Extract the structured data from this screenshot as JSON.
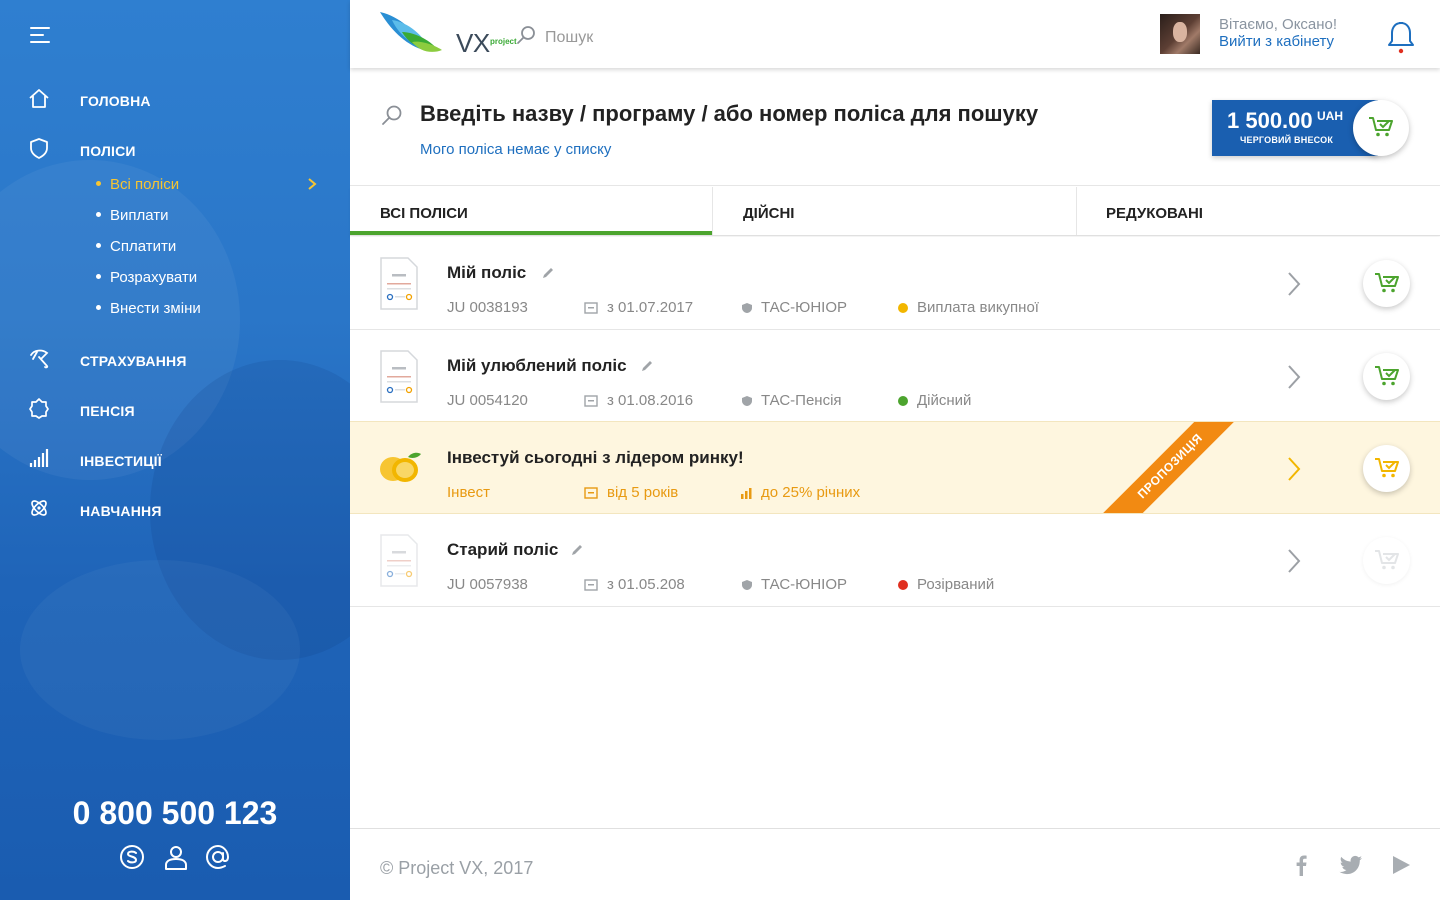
{
  "sidebar": {
    "menu_icon": "hamburger-icon",
    "items": [
      {
        "label": "ГОЛОВНА",
        "icon": "home-icon"
      },
      {
        "label": "ПОЛІСИ",
        "icon": "shield-icon"
      },
      {
        "label": "СТРАХУВАННЯ",
        "icon": "umbrella-icon"
      },
      {
        "label": "ПЕНСІЯ",
        "icon": "badge-icon"
      },
      {
        "label": "ІНВЕСТИЦІЇ",
        "icon": "bar-chart-icon"
      },
      {
        "label": "НАВЧАННЯ",
        "icon": "atom-icon"
      }
    ],
    "subitems": [
      {
        "label": "Всі поліси",
        "active": true
      },
      {
        "label": "Виплати"
      },
      {
        "label": "Сплатити"
      },
      {
        "label": "Розрахувати"
      },
      {
        "label": "Внести зміни"
      }
    ],
    "phone": "0 800 500 123",
    "contacts": [
      "skype-icon",
      "user-icon",
      "at-icon"
    ]
  },
  "header": {
    "logo_text": "VX",
    "logo_sub": "project",
    "search_placeholder": "Пошук",
    "greeting": "Вітаємо, Оксано!",
    "logout": "Вийти з кабінету"
  },
  "search_section": {
    "title": "Введіть назву / програму / або номер поліса для пошуку",
    "link": "Мого поліса немає у списку"
  },
  "payment": {
    "amount": "1 500.00",
    "currency": "UAH",
    "label": "ЧЕРГОВИЙ ВНЕСОК"
  },
  "tabs": [
    {
      "label": "ВСІ ПОЛІСИ",
      "active": true
    },
    {
      "label": "ДІЙСНІ"
    },
    {
      "label": "РЕДУКОВАНІ"
    }
  ],
  "policies": [
    {
      "title": "Мій поліс",
      "number": "JU 0038193",
      "date": "з 01.07.2017",
      "program": "ТАС-ЮНІОР",
      "status": "Виплата викупної",
      "status_color": "#f2b600"
    },
    {
      "title": "Мій улюблений поліс",
      "number": "JU 0054120",
      "date": "з 01.08.2016",
      "program": "ТАС-Пенсія",
      "status": "Дійсний",
      "status_color": "#4ca42e"
    },
    {
      "title": "Старий поліс",
      "number": "JU 0057938",
      "date": "з 01.05.208",
      "program": "ТАС-ЮНІОР",
      "status": "Розірваний",
      "status_color": "#e02f1f"
    }
  ],
  "promo": {
    "title": "Інвестуй сьогодні з лідером ринку!",
    "category": "Інвест",
    "term": "від 5 років",
    "yield": "до 25% річних",
    "ribbon": "ПРОПОЗИЦІЯ",
    "icon": "lemon-icon"
  },
  "footer": {
    "copyright": "© Project VX, 2017",
    "social": [
      "facebook-icon",
      "twitter-icon",
      "youtube-icon"
    ]
  },
  "colors": {
    "sidebar": "#2a76c8",
    "accent_green": "#4ca42e",
    "link_blue": "#1e6fbf",
    "active_yellow": "#f7c531",
    "promo_orange": "#f28a12",
    "promo_text": "#e89a12"
  }
}
